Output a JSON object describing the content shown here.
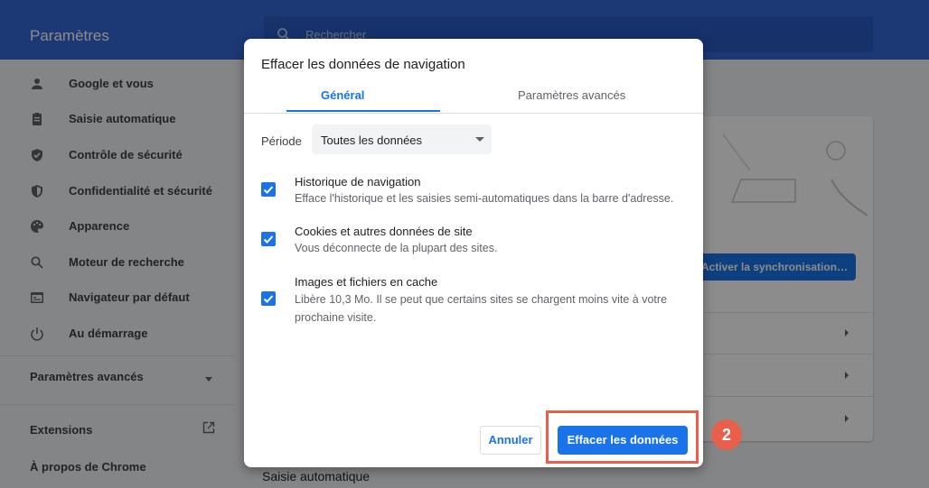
{
  "header": {
    "title": "Paramètres",
    "search_placeholder": "Rechercher"
  },
  "sidebar": {
    "items": [
      {
        "label": "Google et vous",
        "icon": "person-icon"
      },
      {
        "label": "Saisie automatique",
        "icon": "clipboard-icon"
      },
      {
        "label": "Contrôle de sécurité",
        "icon": "shield-check-icon"
      },
      {
        "label": "Confidentialité et sécurité",
        "icon": "shield-lock-icon"
      },
      {
        "label": "Apparence",
        "icon": "palette-icon"
      },
      {
        "label": "Moteur de recherche",
        "icon": "search-icon"
      },
      {
        "label": "Navigateur par défaut",
        "icon": "browser-icon"
      },
      {
        "label": "Au démarrage",
        "icon": "power-icon"
      }
    ],
    "advanced": "Paramètres avancés",
    "extensions": "Extensions",
    "about": "À propos de Chrome"
  },
  "main": {
    "sync_button": "Activer la synchronisation…",
    "bottom_section": "Saisie automatique"
  },
  "dialog": {
    "title": "Effacer les données de navigation",
    "tabs": [
      {
        "label": "Général",
        "active": true
      },
      {
        "label": "Paramètres avancés",
        "active": false
      }
    ],
    "period_label": "Période",
    "period_value": "Toutes les données",
    "options": [
      {
        "title": "Historique de navigation",
        "description": "Efface l'historique et les saisies semi-automatiques dans la barre d'adresse.",
        "checked": true
      },
      {
        "title": "Cookies et autres données de site",
        "description": "Vous déconnecte de la plupart des sites.",
        "checked": true
      },
      {
        "title": "Images et fichiers en cache",
        "description": "Libère 10,3 Mo. Il se peut que certains sites se chargent moins vite à votre prochaine visite.",
        "checked": true
      }
    ],
    "cancel_label": "Annuler",
    "confirm_label": "Effacer les données"
  },
  "annotation": {
    "step": "2",
    "color": "#e8604c"
  },
  "colors": {
    "accent": "#1a73e8",
    "header": "#3367d6"
  }
}
